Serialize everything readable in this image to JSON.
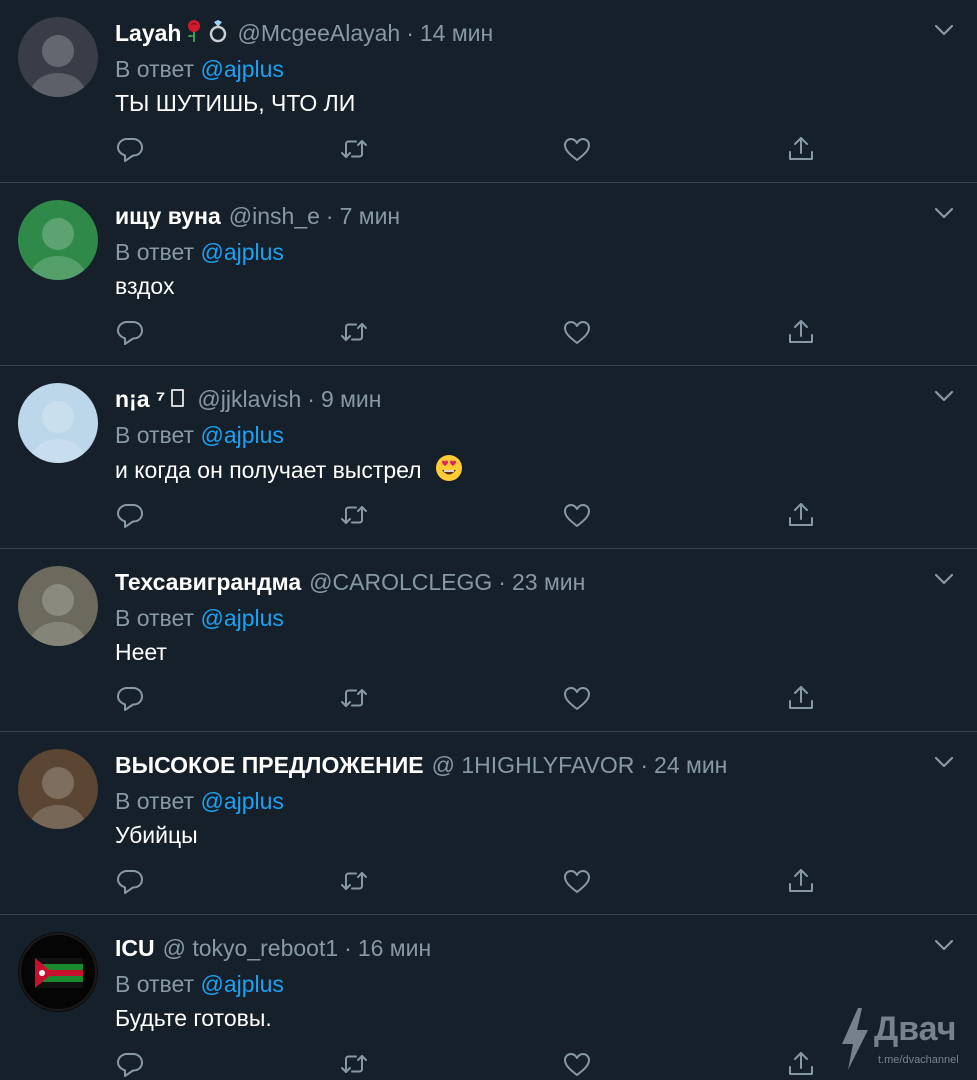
{
  "replies": [
    {
      "name": "Layah",
      "badges": [
        "rose",
        "ring"
      ],
      "handle": "@McgeeAlayah",
      "separator": "·",
      "time": "14 мин",
      "reply_prefix": "В ответ",
      "reply_to": "@ajplus",
      "text": "ТЫ ШУТИШЬ, ЧТО ЛИ",
      "avatar_color": "#3a3d48"
    },
    {
      "name": "ищу вуна",
      "badges": [],
      "handle": "@insh_e",
      "separator": "·",
      "time": "7 мин",
      "reply_prefix": "В ответ",
      "reply_to": "@ajplus",
      "text": "вздох",
      "avatar_color": "#2f8a4a"
    },
    {
      "name": "n¡a ⁷",
      "badges": [
        "missing-glyph"
      ],
      "handle": "@jjklavish",
      "separator": "·",
      "time": "9 мин",
      "reply_prefix": "В ответ",
      "reply_to": "@ajplus",
      "text": "и когда он получает выстрел",
      "text_emoji": "heart-eyes-emoji",
      "avatar_color": "#bcd6ea"
    },
    {
      "name": "Техсавиграндма",
      "badges": [],
      "handle": "@CAROLCLEGG",
      "separator": "·",
      "time": "23 мин",
      "reply_prefix": "В ответ",
      "reply_to": "@ajplus",
      "text": "Неет",
      "avatar_color": "#6b6a5c"
    },
    {
      "name": "ВЫСОКОЕ ПРЕДЛОЖЕНИЕ",
      "badges": [],
      "handle": "@ 1HIGHLYFAVOR",
      "separator": "·",
      "time": "24 мин",
      "reply_prefix": "В ответ",
      "reply_to": "@ajplus",
      "text": "Убийцы",
      "avatar_color": "#5a4632"
    },
    {
      "name": "ICU",
      "badges": [],
      "handle": "@ tokyo_reboot1",
      "separator": "·",
      "time": "16 мин",
      "reply_prefix": "В ответ",
      "reply_to": "@ajplus",
      "text": "Будьте готовы.",
      "avatar_color": "#0a0a0a"
    }
  ],
  "icons": {
    "reply": "reply-icon",
    "retweet": "retweet-icon",
    "like": "like-icon",
    "share": "share-icon",
    "more": "chevron-down-icon"
  },
  "colors": {
    "background": "#15202b",
    "divider": "#38444d",
    "muted": "#8899a6",
    "accent": "#1da1f2",
    "text": "#ffffff"
  },
  "watermark": {
    "brand": "Двач",
    "link": "t.me/dvachannel"
  }
}
